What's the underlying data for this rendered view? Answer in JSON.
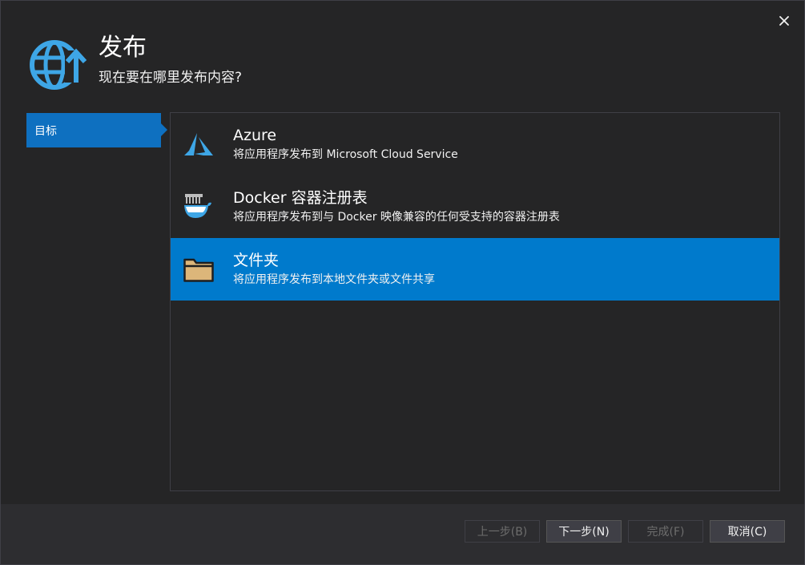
{
  "dialog": {
    "title": "发布",
    "subtitle": "现在要在哪里发布内容?",
    "close_icon": "close-icon",
    "header_icon": "globe-publish-icon",
    "accent": "#007acc"
  },
  "sidebar": {
    "items": [
      {
        "label": "目标",
        "selected": true
      }
    ]
  },
  "targets": [
    {
      "name": "Azure",
      "description": "将应用程序发布到 Microsoft Cloud Service",
      "icon": "azure-icon",
      "selected": false
    },
    {
      "name": "Docker 容器注册表",
      "description": "将应用程序发布到与 Docker 映像兼容的任何受支持的容器注册表",
      "icon": "docker-icon",
      "selected": false
    },
    {
      "name": "文件夹",
      "description": "将应用程序发布到本地文件夹或文件共享",
      "icon": "folder-icon",
      "selected": true
    }
  ],
  "footer": {
    "prev_label": "上一步(B)",
    "next_label": "下一步(N)",
    "finish_label": "完成(F)",
    "cancel_label": "取消(C)",
    "prev_enabled": false,
    "finish_enabled": false
  }
}
